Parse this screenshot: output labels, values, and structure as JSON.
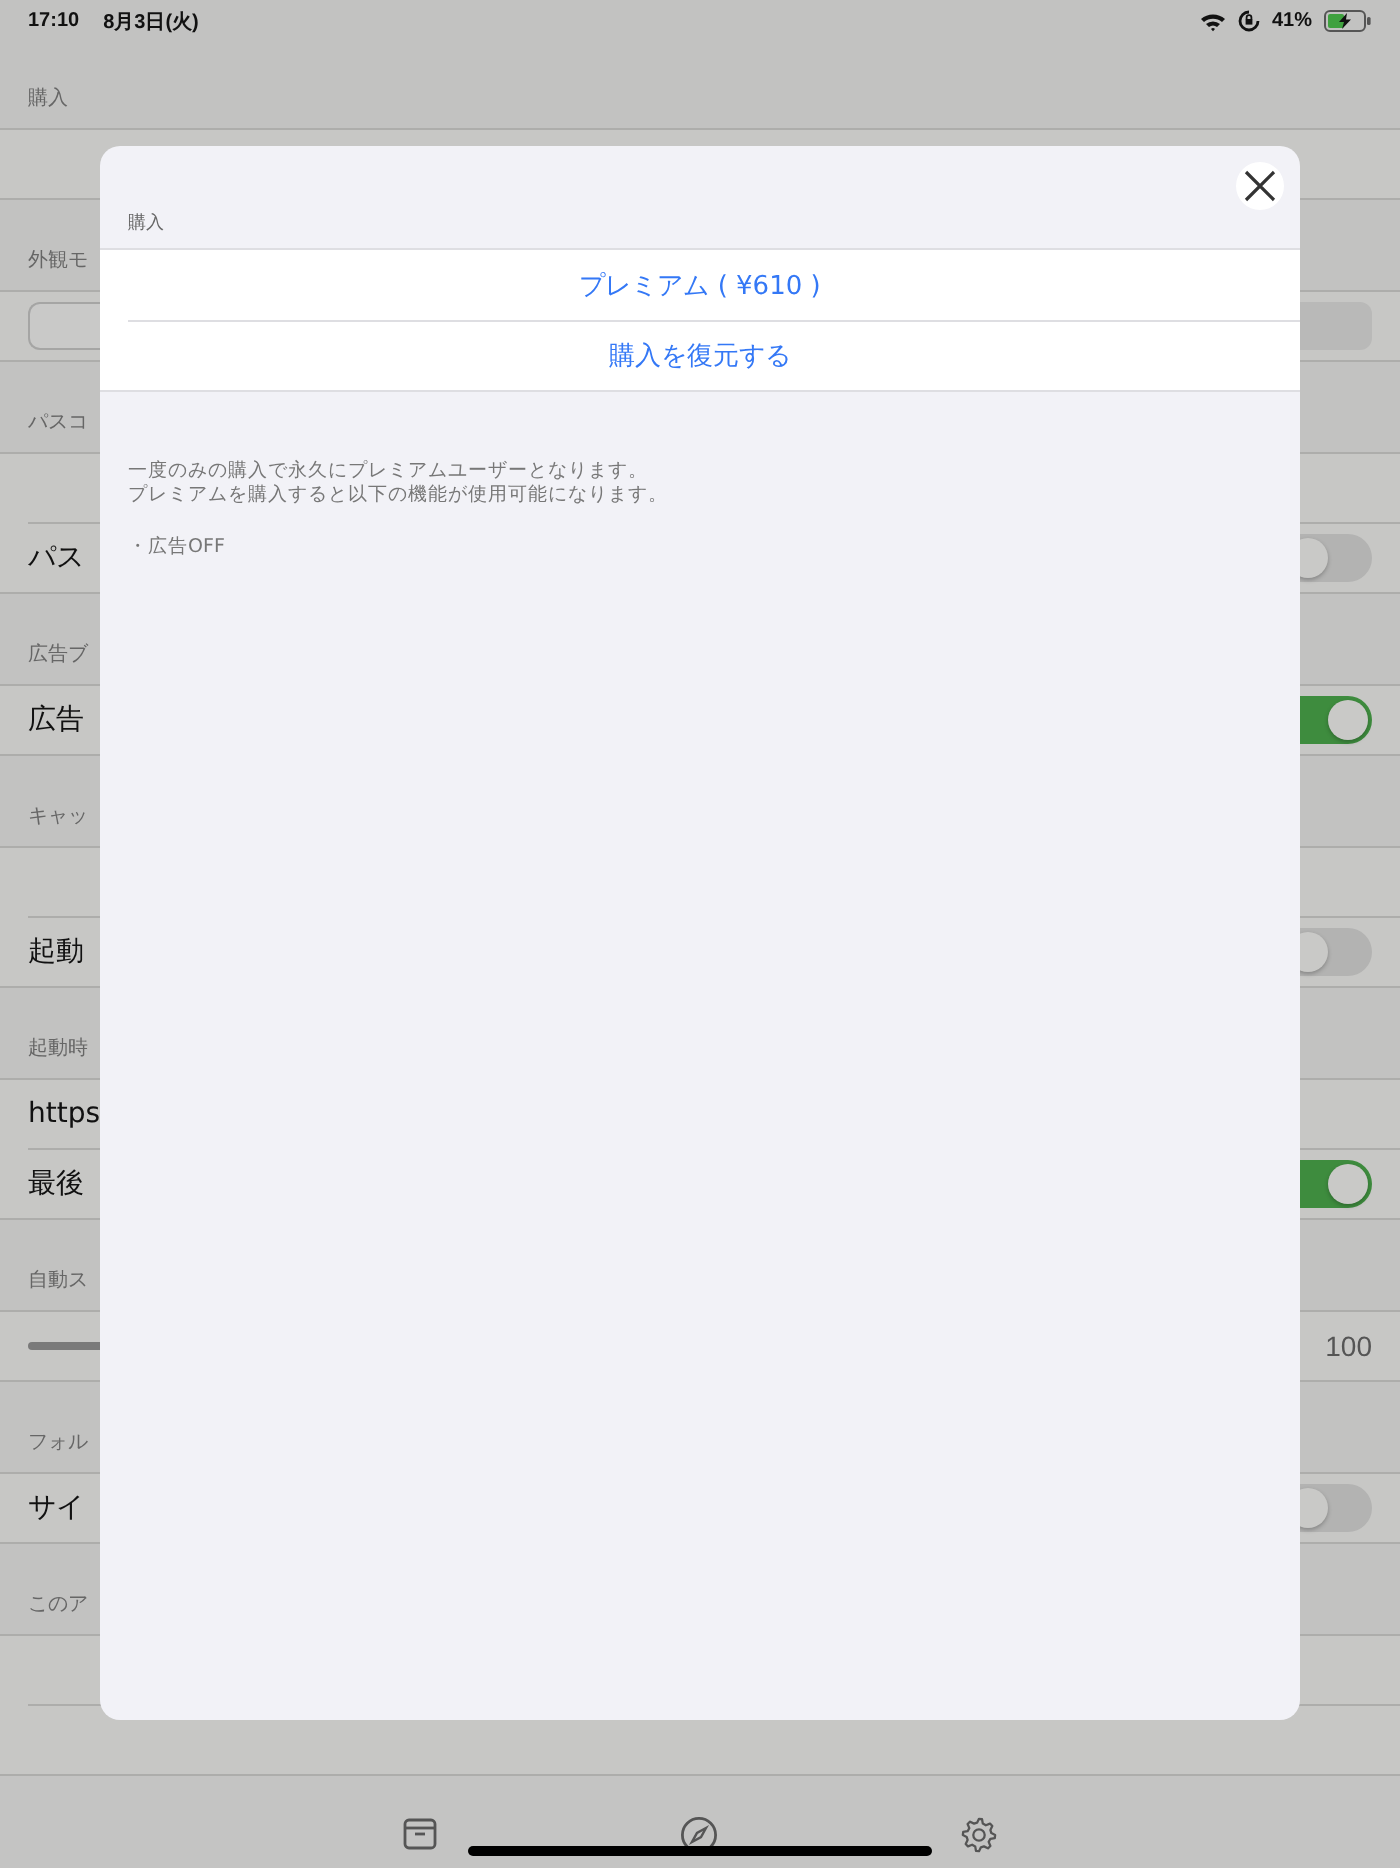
{
  "status_bar": {
    "time": "17:10",
    "date": "8月3日(火)",
    "battery": "41%"
  },
  "settings": {
    "sections": [
      {
        "header": "購入",
        "rows": [
          {
            "kind": "blank"
          }
        ]
      },
      {
        "header": "外観モ",
        "rows": [
          {
            "kind": "segmented"
          }
        ]
      },
      {
        "header": "パスコ",
        "rows": [
          {
            "kind": "blank"
          },
          {
            "kind": "toggle",
            "label": "パス",
            "on": false
          }
        ]
      },
      {
        "header": "広告ブ",
        "rows": [
          {
            "kind": "toggle",
            "label": "広告",
            "on": true
          }
        ]
      },
      {
        "header": "キャッ",
        "rows": [
          {
            "kind": "blank"
          },
          {
            "kind": "toggle",
            "label": "起動",
            "on": false
          }
        ]
      },
      {
        "header": "起動時",
        "rows": [
          {
            "kind": "text",
            "label": "https"
          },
          {
            "kind": "toggle",
            "label": "最後",
            "on": true
          }
        ]
      },
      {
        "header": "自動ス",
        "rows": [
          {
            "kind": "slider",
            "reading": "100"
          }
        ]
      },
      {
        "header": "フォル",
        "rows": [
          {
            "kind": "toggle",
            "label": "サイ",
            "on": false
          }
        ]
      },
      {
        "header": "このア",
        "rows": [
          {
            "kind": "blank"
          },
          {
            "kind": "blank"
          }
        ]
      }
    ]
  },
  "tab_bar": [
    {
      "kind": "archive"
    },
    {
      "kind": "compass"
    },
    {
      "kind": "gear"
    }
  ],
  "modal": {
    "section_header": "購入",
    "buttons": [
      "プレミアム ( ¥610 )",
      "購入を復元する"
    ],
    "description": [
      "一度のみの購入で永久にプレミアムユーザーとなります。",
      "プレミアムを購入すると以下の機能が使用可能になります。"
    ],
    "features": [
      "・広告OFF"
    ]
  }
}
